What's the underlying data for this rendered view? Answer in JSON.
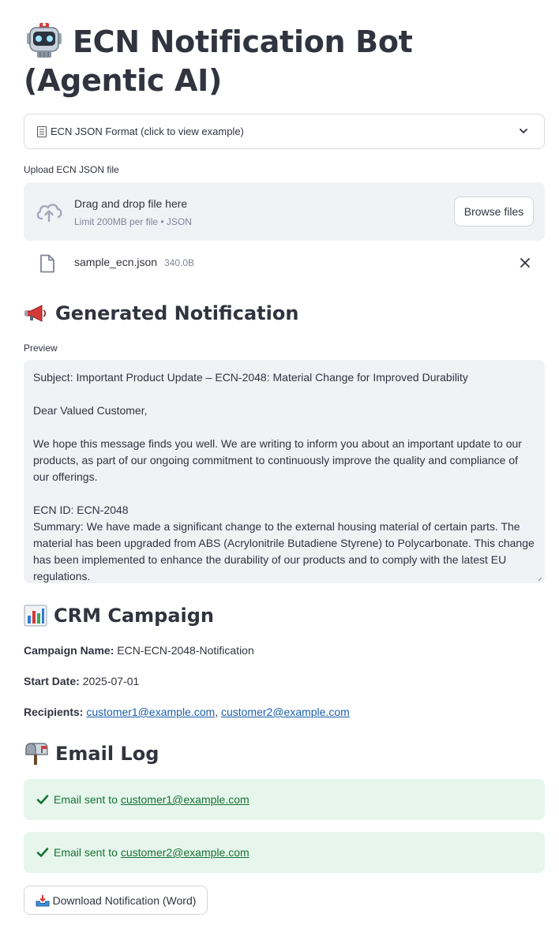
{
  "app": {
    "title": "ECN Notification Bot (Agentic AI)",
    "title_icon": "robot-icon"
  },
  "expander": {
    "label": "ECN JSON Format (click to view example)",
    "icon": "document-icon"
  },
  "uploader": {
    "label": "Upload ECN JSON file",
    "drop_text": "Drag and drop file here",
    "limit_text": "Limit 200MB per file • JSON",
    "browse_label": "Browse files",
    "file": {
      "name": "sample_ecn.json",
      "size": "340.0B"
    }
  },
  "notification": {
    "heading": "Generated Notification",
    "heading_icon": "megaphone-icon",
    "preview_label": "Preview",
    "lines": {
      "subject": "Subject: Important Product Update – ECN-2048: Material Change for Improved Durability",
      "greeting": "Dear Valued Customer,",
      "para1": "We hope this message finds you well. We are writing to inform you about an important update to our products, as part of our ongoing commitment to continuously improve the quality and compliance of our offerings.",
      "ecn_id": "ECN ID: ECN-2048",
      "summary": "Summary: We have made a significant change to the external housing material of certain parts. The material has been upgraded from ABS (Acrylonitrile Butadiene Styrene) to Polycarbonate. This change has been implemented to enhance the durability of our products and to comply with the latest EU regulations."
    }
  },
  "crm": {
    "heading": "CRM Campaign",
    "heading_icon": "bar-chart-icon",
    "campaign_label": "Campaign Name:",
    "campaign_value": "ECN-ECN-2048-Notification",
    "start_label": "Start Date:",
    "start_value": "2025-07-01",
    "recipients_label": "Recipients:",
    "recipients": [
      "customer1@example.com",
      "customer2@example.com"
    ],
    "separator": ", "
  },
  "email_log": {
    "heading": "Email Log",
    "heading_icon": "mailbox-icon",
    "prefix": "Email sent to",
    "entries": [
      "customer1@example.com",
      "customer2@example.com"
    ]
  },
  "download": {
    "label": "Download Notification (Word)",
    "icon": "inbox-tray-icon"
  },
  "colors": {
    "text": "#31333f",
    "link": "#1c5faa",
    "success_bg": "#e6f6ec",
    "success_text": "#177233",
    "panel_bg": "#f0f2f6"
  }
}
